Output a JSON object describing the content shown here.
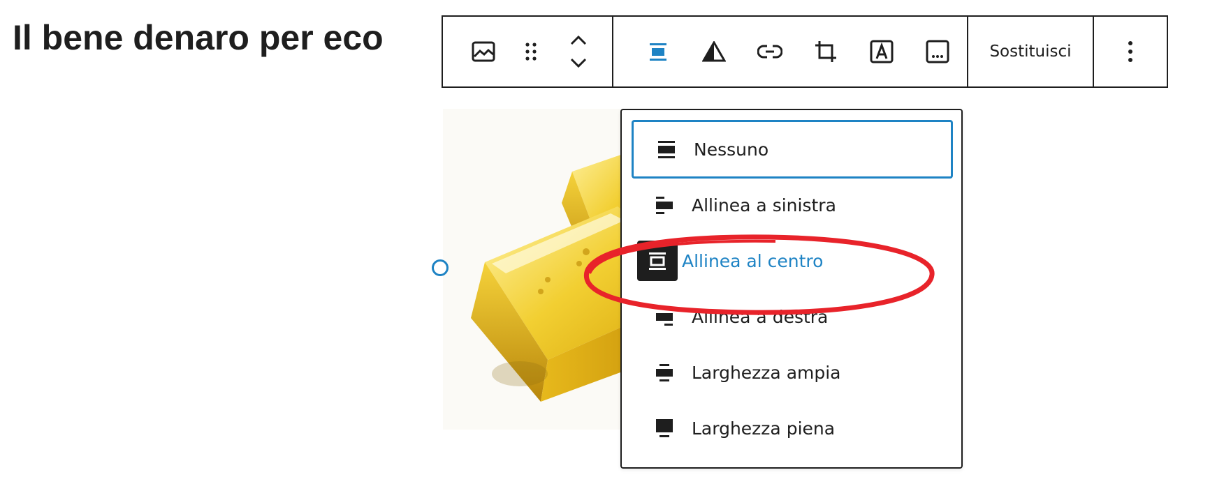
{
  "heading": "Il bene denaro per eco",
  "toolbar": {
    "buttons": [
      "image-icon",
      "drag-handle-icon",
      "move-up-icon",
      "move-down-icon",
      "align-center-icon",
      "duotone-icon",
      "link-icon",
      "crop-icon",
      "text-overlay-icon",
      "caption-icon",
      "more-options-icon"
    ],
    "replace_label": "Sostituisci",
    "accent_color": "#1e83c4"
  },
  "alignment_menu": {
    "items": [
      {
        "label": "Nessuno",
        "state": "focused"
      },
      {
        "label": "Allinea a sinistra"
      },
      {
        "label": "Allinea al centro",
        "state": "active"
      },
      {
        "label": "Allinea a destra"
      },
      {
        "label": "Larghezza ampia"
      },
      {
        "label": "Larghezza piena"
      }
    ]
  },
  "annotation_color": "#e8232a"
}
